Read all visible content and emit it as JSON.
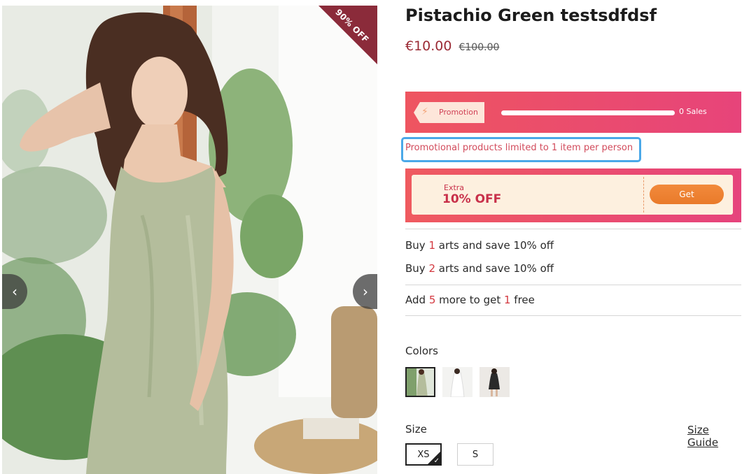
{
  "gallery": {
    "ribbon_text": "90% OFF",
    "prev_icon": "chevron-left-icon",
    "next_icon": "chevron-right-icon",
    "prev_glyph": "‹",
    "next_glyph": "›"
  },
  "product": {
    "title": "Pistachio Green testsdfdsf",
    "price": "€10.00",
    "old_price": "€100.00"
  },
  "promotion": {
    "tag_label": "Promotion",
    "tag_icon": "bolt-icon",
    "tag_glyph": "⚡",
    "progress": 0,
    "sales_text": "0 Sales",
    "limit_text": "Promotional products limited to 1 item per person"
  },
  "coupon": {
    "extra_label": "Extra",
    "off_label": "10% OFF",
    "button_label": "Get"
  },
  "offers": {
    "line1": {
      "pre": "Buy ",
      "num": "1",
      "post": " arts and save 10% off"
    },
    "line2": {
      "pre": "Buy ",
      "num": "2",
      "post": " arts and save 10% off"
    },
    "line3": {
      "pre": "Add ",
      "num": "5",
      "mid": " more to get ",
      "num2": "1",
      "post": " free"
    }
  },
  "colors": {
    "label": "Colors",
    "swatches": [
      "green-dress",
      "white-dress",
      "black-dress"
    ],
    "selected": 0
  },
  "size": {
    "label": "Size",
    "guide_label": "Size Guide",
    "options": [
      "XS",
      "S"
    ],
    "selected": "XS"
  },
  "theme": {
    "accent": "#9b2b35",
    "promo_gradient_start": "#ee5560",
    "promo_gradient_end": "#e7447a",
    "highlight": "#d3383f",
    "limit_border": "#4aa8e8",
    "get_button": "#f28a3c"
  }
}
